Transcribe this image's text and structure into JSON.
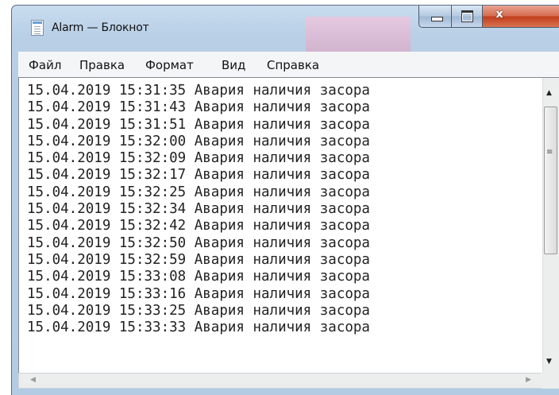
{
  "window": {
    "title": "Alarm — Блокнот",
    "app_icon": "notepad-icon"
  },
  "controls": {
    "minimize": "minimize-icon",
    "maximize": "maximize-icon",
    "close": "x"
  },
  "menu": [
    "Файл",
    "Правка",
    "Формат",
    "Вид",
    "Справка"
  ],
  "lines": [
    "15.04.2019 15:31:35 Авария наличия засора",
    "15.04.2019 15:31:43 Авария наличия засора",
    "15.04.2019 15:31:51 Авария наличия засора",
    "15.04.2019 15:32:00 Авария наличия засора",
    "15.04.2019 15:32:09 Авария наличия засора",
    "15.04.2019 15:32:17 Авария наличия засора",
    "15.04.2019 15:32:25 Авария наличия засора",
    "15.04.2019 15:32:34 Авария наличия засора",
    "15.04.2019 15:32:42 Авария наличия засора",
    "15.04.2019 15:32:50 Авария наличия засора",
    "15.04.2019 15:32:59 Авария наличия засора",
    "15.04.2019 15:33:08 Авария наличия засора",
    "15.04.2019 15:33:16 Авария наличия засора",
    "15.04.2019 15:33:25 Авария наличия засора",
    "15.04.2019 15:33:33 Авария наличия засора"
  ]
}
